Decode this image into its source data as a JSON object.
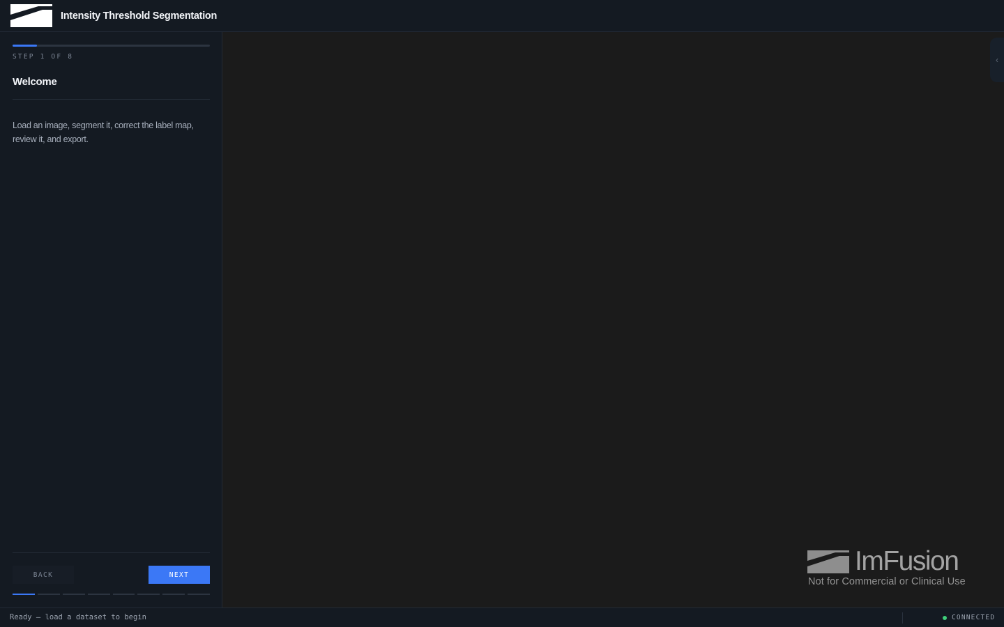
{
  "app": {
    "title": "Intensity Threshold Segmentation",
    "logo_icon": "imfusion-logo-icon"
  },
  "wizard": {
    "current_step": 1,
    "total_steps": 8,
    "progress_fraction": 0.125,
    "step_label": "STEP 1 OF 8",
    "step_title": "Welcome",
    "description": "Load an image, segment it, correct the label map, review it, and export.",
    "back_label": "BACK",
    "next_label": "NEXT"
  },
  "viewer": {
    "collapse_icon": "chevron-left-icon",
    "watermark": {
      "brand": "ImFusion",
      "notice": "Not for Commercial or Clinical Use"
    }
  },
  "status": {
    "message": "Ready — load a dataset to begin",
    "connection": "CONNECTED"
  },
  "colors": {
    "accent": "#3b78f6",
    "connected": "#3ecf7a",
    "panel": "#141a22",
    "viewport": "#1b1b1b"
  }
}
